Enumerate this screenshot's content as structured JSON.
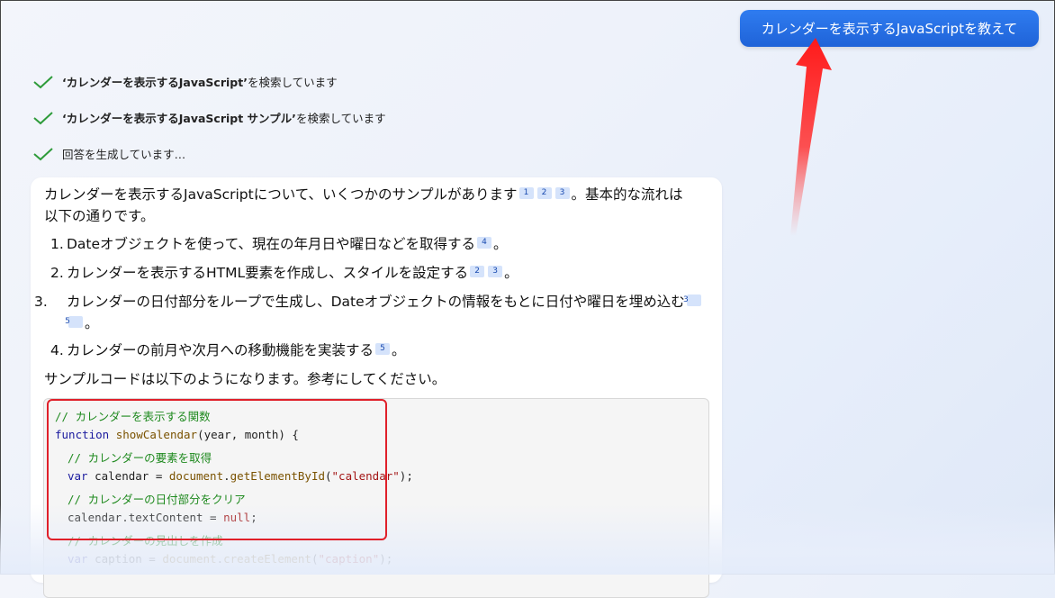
{
  "user_message": "カレンダーを表示するJavaScriptを教えて",
  "status": [
    {
      "quoted": "‘カレンダーを表示するJavaScript’",
      "suffix": " を検索しています"
    },
    {
      "quoted": "‘カレンダーを表示するJavaScript サンプル’",
      "suffix": " を検索しています"
    },
    {
      "quoted": "",
      "suffix": "回答を生成しています…"
    }
  ],
  "answer": {
    "intro_a": "カレンダーを表示するJavaScriptについて、いくつかのサンプルがあります",
    "intro_cites": [
      "1",
      "2",
      "3"
    ],
    "intro_b": "。基本的な流れは",
    "intro_c": "以下の通りです。",
    "items": [
      {
        "num": "1.",
        "text": "Dateオブジェクトを使って、現在の年月日や曜日などを取得する",
        "cites": [
          "4"
        ],
        "end": "。"
      },
      {
        "num": "2.",
        "text": "カレンダーを表示するHTML要素を作成し、スタイルを設定する",
        "cites": [
          "2",
          "3"
        ],
        "end": "。"
      },
      {
        "num": "3.",
        "text": "カレンダーの日付部分をループで生成し、Dateオブジェクトの情報をもとに日付や曜日を埋め込む",
        "cites": [
          "3",
          "5"
        ],
        "end": "。"
      },
      {
        "num": "4.",
        "text": "カレンダーの前月や次月への移動機能を実装する",
        "cites": [
          "5"
        ],
        "end": "。"
      }
    ],
    "sample_intro": "サンプルコードは以下のようになります。参考にしてください。"
  },
  "code": {
    "l1": "// カレンダーを表示する関数",
    "l2_kw": "function",
    "l2_fn": "showCalendar",
    "l2_rest": "(year, month) {",
    "l3": "// カレンダーの要素を取得",
    "l4_kw": "var",
    "l4_mid": " calendar = ",
    "l4_obj": "document",
    "l4_dot": ".",
    "l4_fn": "getElementById",
    "l4_open": "(",
    "l4_str": "\"calendar\"",
    "l4_close": ");",
    "l5": "// カレンダーの日付部分をクリア",
    "l6_a": "calendar.textContent = ",
    "l6_null": "null",
    "l6_end": ";",
    "l7": "// カレンダーの見出しを作成",
    "l8_kw": "var",
    "l8_mid": " caption = ",
    "l8_obj": "document",
    "l8_dot": ".",
    "l8_fn": "createElement",
    "l8_open": "(",
    "l8_str": "\"caption\"",
    "l8_close": ");"
  },
  "colors": {
    "user_bubble": "#2563eb",
    "annotation": "#e0202a",
    "check": "#2e9b3a"
  }
}
